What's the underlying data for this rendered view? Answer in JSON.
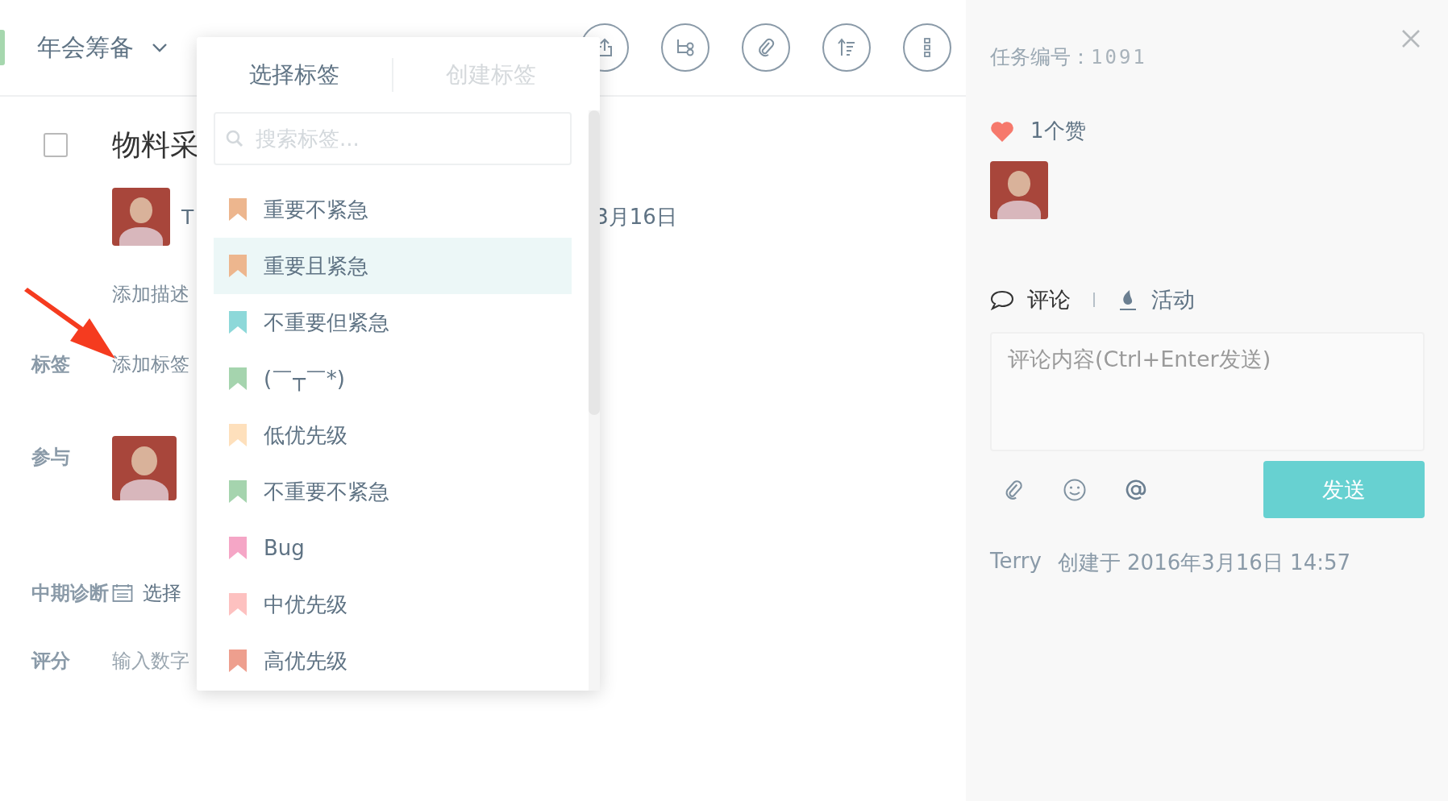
{
  "header": {
    "project": "年会筹备"
  },
  "task": {
    "checked": false,
    "title": "物料采",
    "assignee": "T",
    "due": "3月16日",
    "description_link": "添加描述"
  },
  "fields": [
    {
      "kind": "link",
      "label": "标签",
      "value": "添加标签"
    },
    {
      "kind": "avatars",
      "label": "参与"
    },
    {
      "kind": "date",
      "label": "中期诊断",
      "value": "选择"
    },
    {
      "kind": "input",
      "label": "评分",
      "placeholder": "输入数字"
    }
  ],
  "tag_picker": {
    "tabs": [
      {
        "label": "选择标签",
        "selected": true
      },
      {
        "label": "创建标签",
        "selected": false
      }
    ],
    "search": {
      "placeholder": "搜索标签..."
    },
    "tags": [
      {
        "name": "重要不紧急",
        "color": "#edb68e",
        "selected": false
      },
      {
        "name": "重要且紧急",
        "color": "#edb68e",
        "selected": true
      },
      {
        "name": "不重要但紧急",
        "color": "#8dd8d9",
        "selected": false
      },
      {
        "name": "(￣┬￣*)",
        "color": "#a5d4ae",
        "selected": false
      },
      {
        "name": "低优先级",
        "color": "#fee0bc",
        "selected": false
      },
      {
        "name": "不重要不紧急",
        "color": "#a5d4ae",
        "selected": false
      },
      {
        "name": "Bug",
        "color": "#f5a6c6",
        "selected": false
      },
      {
        "name": "中优先级",
        "color": "#fdc1c0",
        "selected": false
      },
      {
        "name": "高优先级",
        "color": "#ee9f8e",
        "selected": false
      }
    ]
  },
  "detail": {
    "task_number_label": "任务编号：",
    "task_number": "1091",
    "likes": "1个赞",
    "tabs": [
      {
        "label": "评论",
        "kind": "comment",
        "selected": true
      },
      {
        "label": "活动",
        "kind": "activity",
        "selected": false
      }
    ],
    "comment": {
      "placeholder": "评论内容(Ctrl+Enter发送)"
    },
    "send": "发送",
    "created_by": "Terry",
    "created_text": "创建于 2016年3月16日 14:57"
  }
}
